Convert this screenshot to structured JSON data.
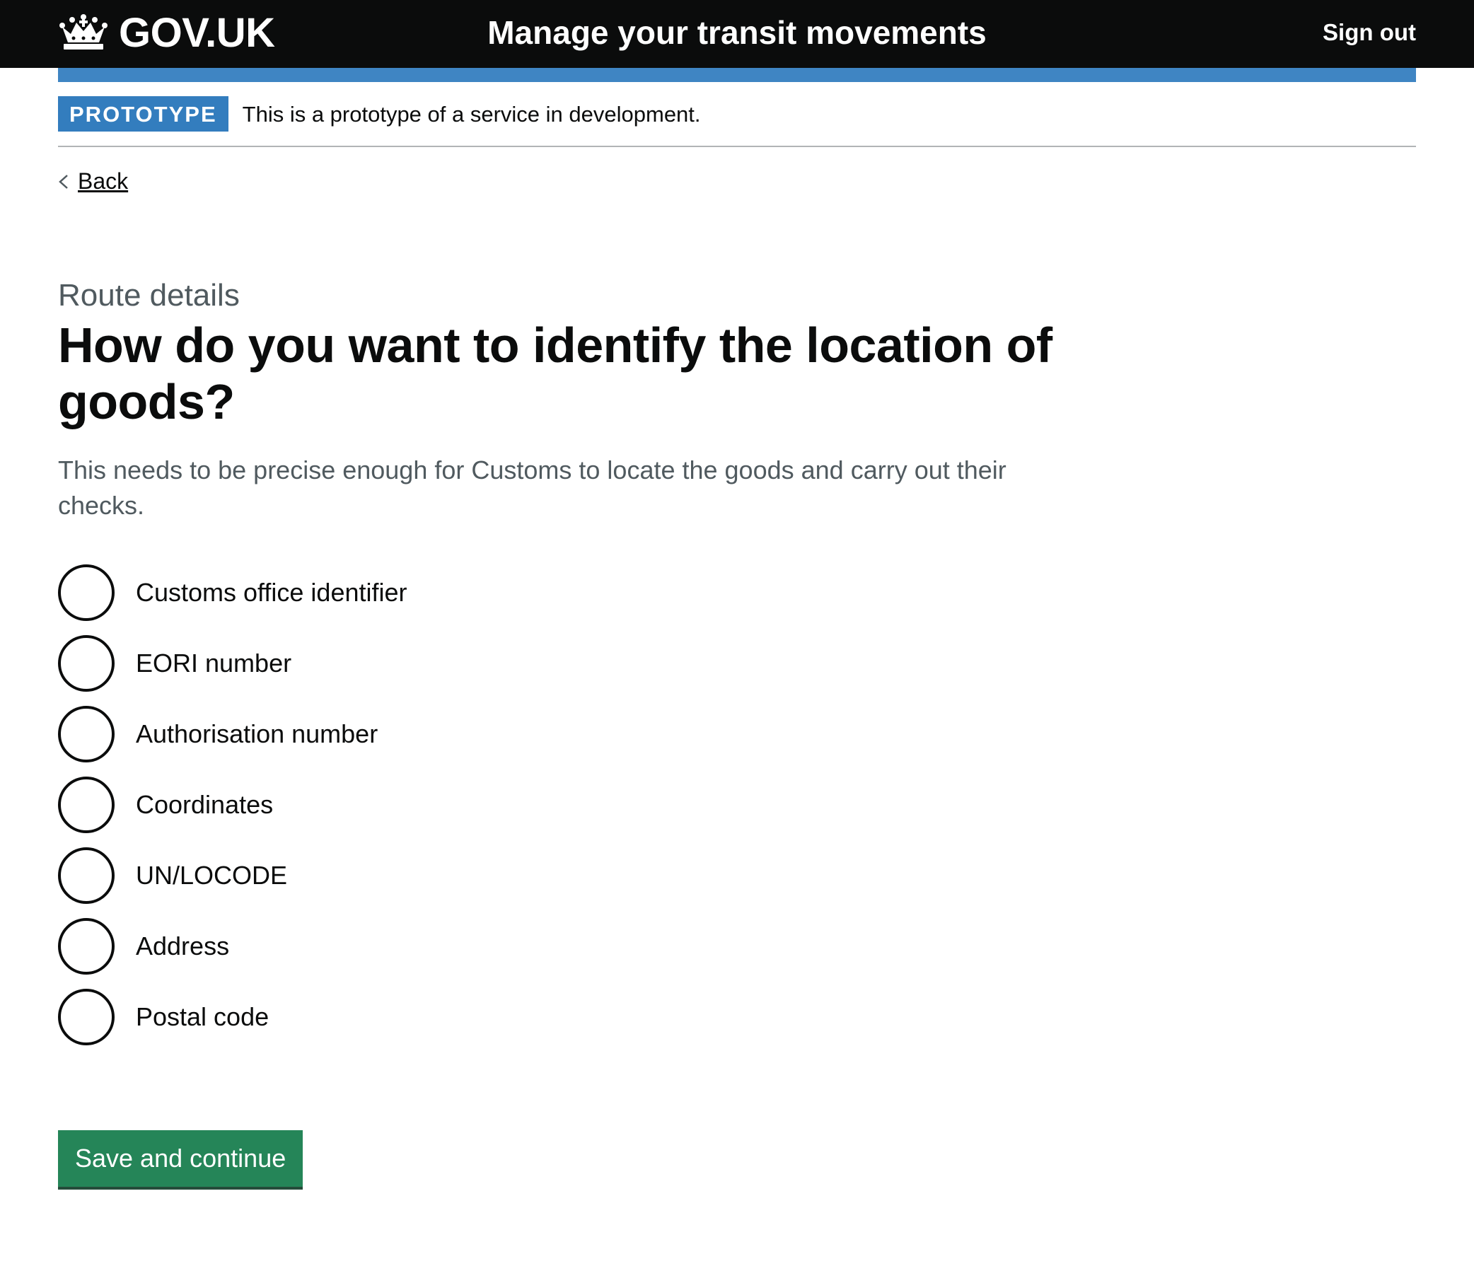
{
  "header": {
    "logo_text": "GOV.UK",
    "service_name": "Manage your transit movements",
    "sign_out": "Sign out"
  },
  "phase_banner": {
    "tag": "PROTOTYPE",
    "text": "This is a prototype of a service in development."
  },
  "back_link": "Back",
  "page": {
    "caption": "Route details",
    "heading": "How do you want to identify the location of goods?",
    "hint": "This needs to be precise enough for Customs to locate the goods and carry out their checks."
  },
  "options": [
    {
      "label": "Customs office identifier"
    },
    {
      "label": "EORI number"
    },
    {
      "label": "Authorisation number"
    },
    {
      "label": "Coordinates"
    },
    {
      "label": "UN/LOCODE"
    },
    {
      "label": "Address"
    },
    {
      "label": "Postal code"
    }
  ],
  "button": {
    "label": "Save and continue"
  },
  "colors": {
    "header_bg": "#0b0c0c",
    "brand_blue": "#1d70b8",
    "button_green": "#00703c",
    "secondary_text": "#505a5f"
  }
}
